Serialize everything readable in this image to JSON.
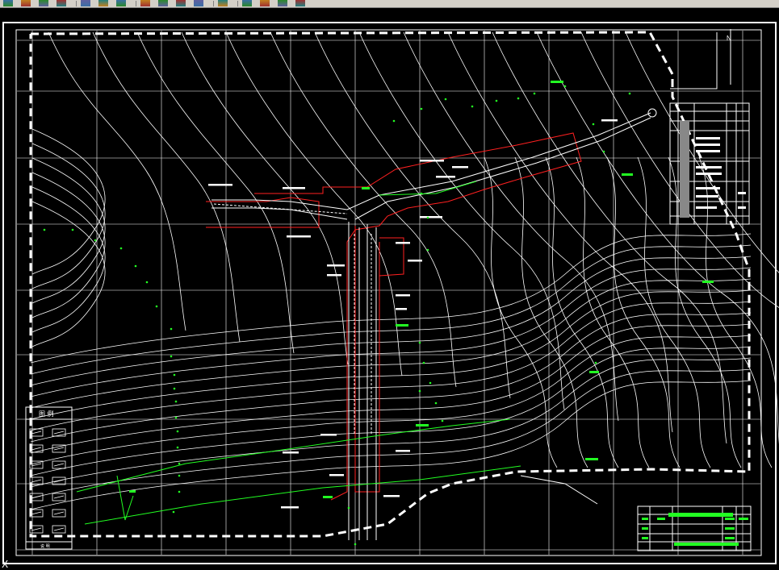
{
  "app": {
    "toolbar_icons": [
      "undo-icon",
      "properties-icon",
      "pan-icon",
      "layer-icon",
      "separator",
      "snap-icon",
      "zoom-icon",
      "zoom-window-icon",
      "separator",
      "text-icon",
      "table-icon",
      "layer-manager-icon",
      "hatch-icon",
      "separator",
      "block-icon",
      "separator",
      "color-icon",
      "render-icon",
      "light-icon",
      "ortho-icon"
    ]
  },
  "drawing": {
    "background_color": "#000000",
    "frame_color": "#ffffff",
    "contour_color": "#ffffff",
    "grid_color": "#ffffff",
    "plan_outline_color": "#ff2020",
    "annotation_color": "#22ff22",
    "boundary_dash_color": "#ffffff",
    "north_arrow_label": "N",
    "legend_title": "图 例",
    "legend_footer": "说 明"
  },
  "ucs_icon_label": "X"
}
